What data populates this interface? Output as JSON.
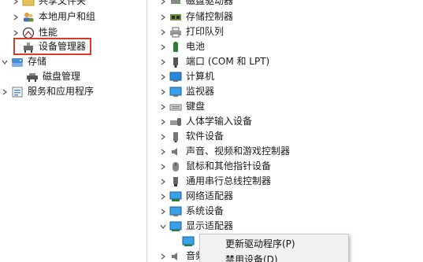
{
  "left_tree": {
    "shared_folders": "共享文件夹",
    "local_users_groups": "本地用户和组",
    "performance": "性能",
    "device_manager": "设备管理器",
    "storage": "存储",
    "disk_management": "磁盘管理",
    "services_apps": "服务和应用程序"
  },
  "device_tree": {
    "disk_drives": "磁盘驱动器",
    "storage_controllers": "存储控制器",
    "print_queues": "打印队列",
    "batteries": "电池",
    "ports": "端口 (COM 和 LPT)",
    "computer": "计算机",
    "monitors": "监视器",
    "keyboards": "键盘",
    "hid": "人体学输入设备",
    "software_devices": "软件设备",
    "sound": "声音、视频和游戏控制器",
    "mice": "鼠标和其他指针设备",
    "usb": "通用串行总线控制器",
    "network_adapters": "网络适配器",
    "system_devices": "系统设备",
    "display_adapters": "显示适配器",
    "audio_partial": "音频"
  },
  "context_menu": {
    "update_driver": "更新驱动程序(P)",
    "disable_device": "禁用设备(D)"
  },
  "colors": {
    "highlight_border": "#d93b2b",
    "menu_bg": "#f2f2f2"
  }
}
